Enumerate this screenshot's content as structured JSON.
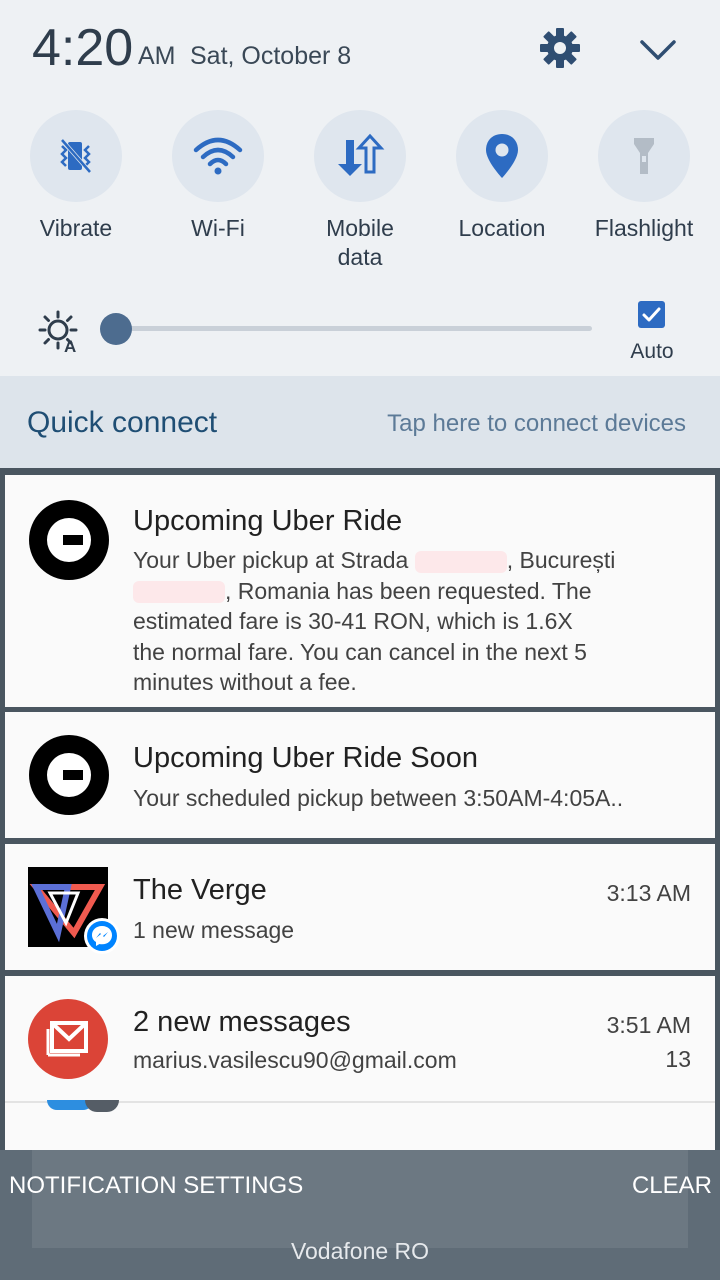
{
  "status": {
    "time": "4:20",
    "ampm": "AM",
    "date": "Sat, October 8"
  },
  "quick_settings": [
    {
      "label": "Vibrate",
      "icon": "vibrate-icon"
    },
    {
      "label": "Wi-Fi",
      "icon": "wifi-icon"
    },
    {
      "label": "Mobile\ndata",
      "icon": "mobile-data-icon"
    },
    {
      "label": "Location",
      "icon": "location-icon"
    },
    {
      "label": "Flashlight",
      "icon": "flashlight-icon"
    }
  ],
  "brightness": {
    "level": 0,
    "auto_label": "Auto",
    "auto_checked": true
  },
  "quick_connect": {
    "title": "Quick connect",
    "hint": "Tap here to connect devices"
  },
  "notifications": [
    {
      "title": "Upcoming Uber Ride",
      "body_line1_a": "Your Uber pickup at Strada ",
      "body_line1_b": ", București",
      "body_line2": ", Romania has been requested. The",
      "body_line3": "estimated fare is 30-41 RON, which is 1.6X",
      "body_line4": "the normal fare. You can cancel in the next 5",
      "body_line5": "minutes without a fee."
    },
    {
      "title": "Upcoming Uber Ride Soon",
      "body": "Your scheduled pickup between 3:50AM-4:05A.."
    },
    {
      "title": "The Verge",
      "body": "1 new message",
      "time": "3:13 AM"
    },
    {
      "title": "2 new messages",
      "body": "marius.vasilescu90@gmail.com",
      "time": "3:51 AM",
      "count": "13"
    }
  ],
  "footer": {
    "settings_label": "NOTIFICATION SETTINGS",
    "clear_label": "CLEAR",
    "carrier": "Vodafone RO"
  },
  "colors": {
    "accent": "#2d6bc2",
    "panel": "#eef1f4",
    "gmail_red": "#db4437",
    "messenger": "#0084ff"
  }
}
